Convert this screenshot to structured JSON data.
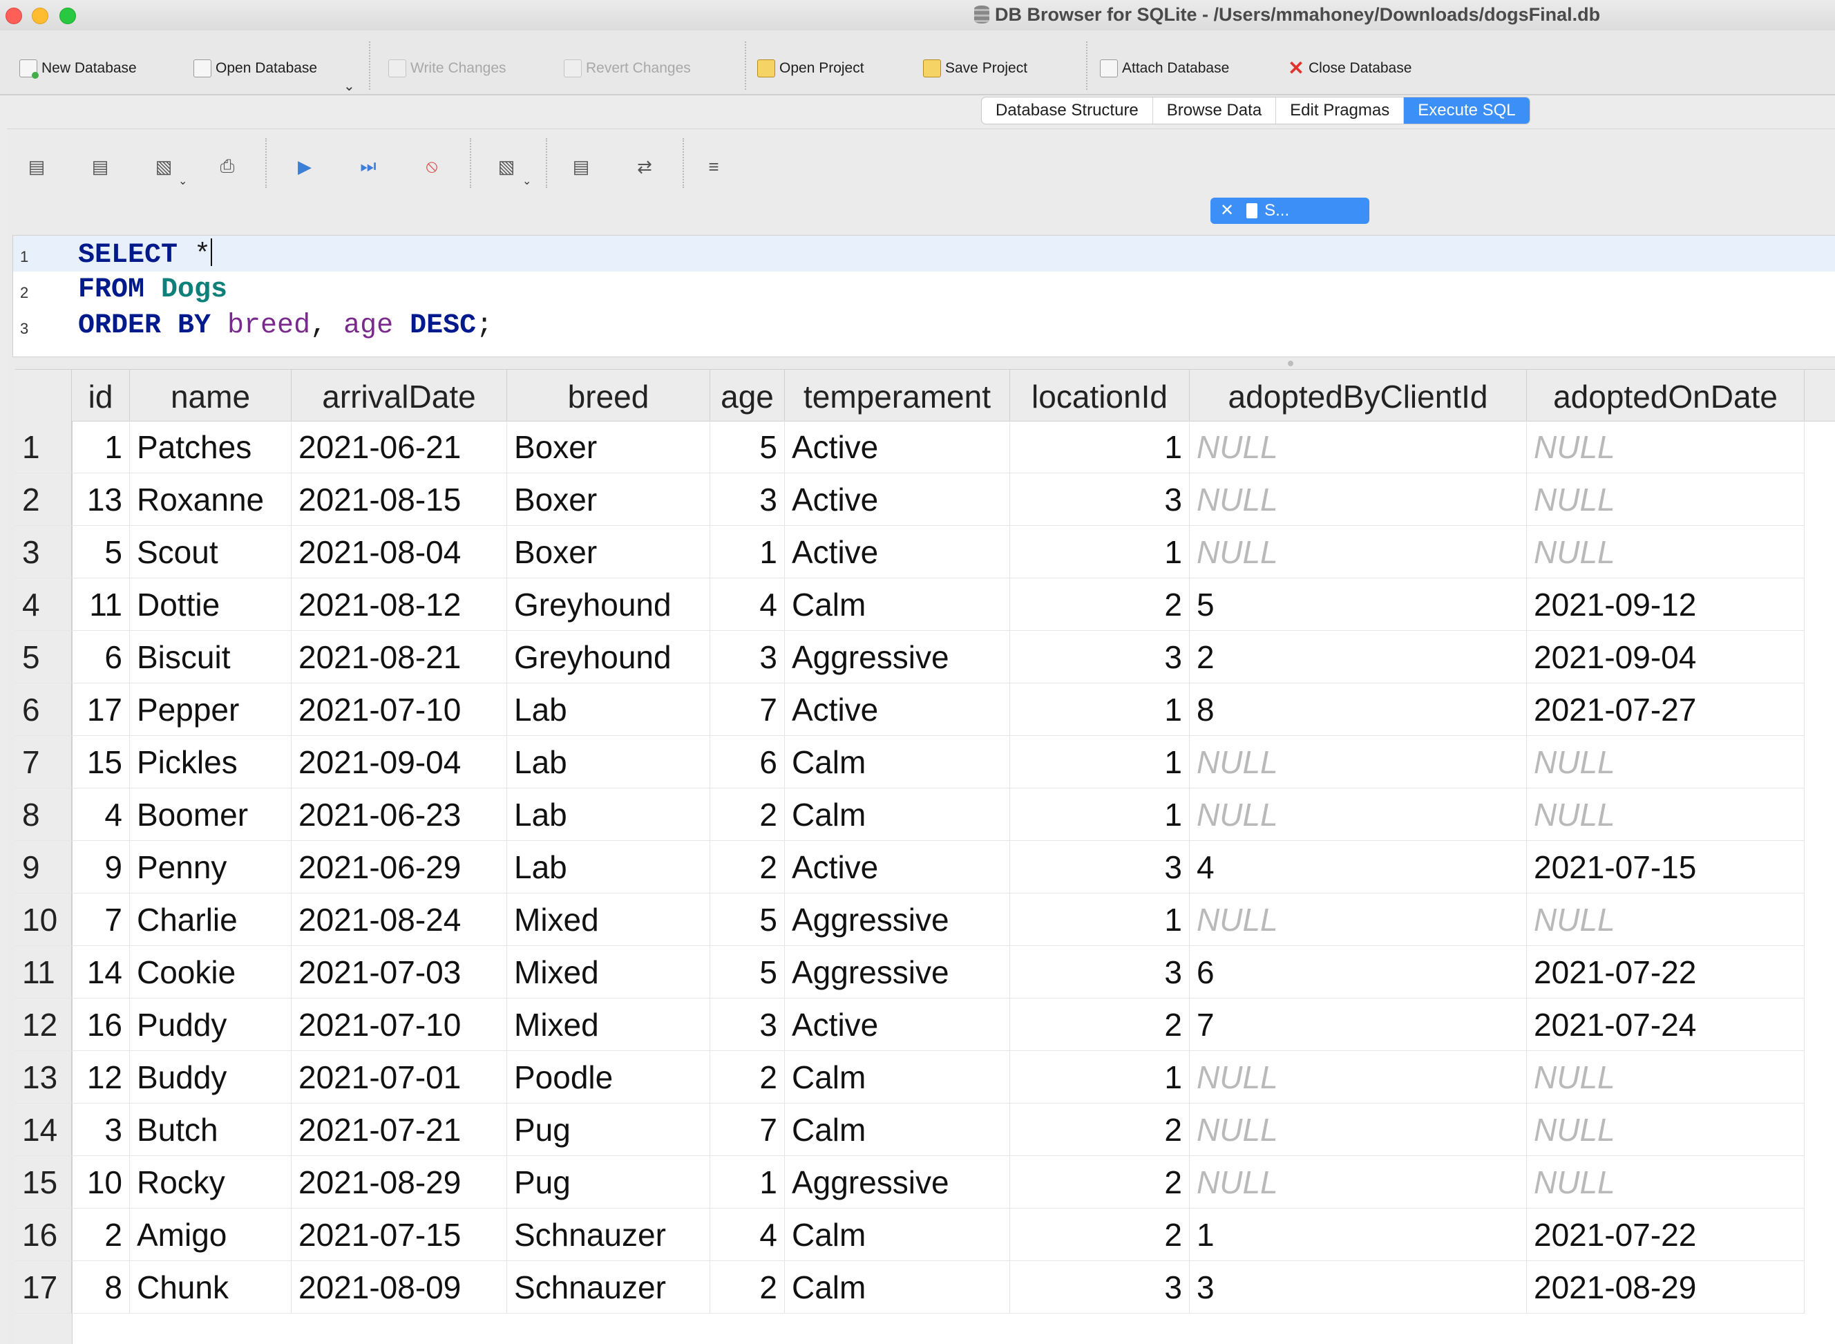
{
  "window": {
    "title": "DB Browser for SQLite - /Users/mmahoney/Downloads/dogsFinal.db"
  },
  "toolbar": {
    "new_database": "New Database",
    "open_database": "Open Database",
    "write_changes": "Write Changes",
    "revert_changes": "Revert Changes",
    "open_project": "Open Project",
    "save_project": "Save Project",
    "attach_database": "Attach Database",
    "close_database": "Close Database"
  },
  "tabs": [
    {
      "label": "Database Structure",
      "active": false
    },
    {
      "label": "Browse Data",
      "active": false
    },
    {
      "label": "Edit Pragmas",
      "active": false
    },
    {
      "label": "Execute SQL",
      "active": true
    }
  ],
  "editor_tab": {
    "label": "S..."
  },
  "sql": {
    "line_numbers": [
      "1",
      "2",
      "3"
    ],
    "line1": {
      "kw": "SELECT",
      "rest": " *"
    },
    "line2": {
      "kw": "FROM",
      "table": "Dogs"
    },
    "line3": {
      "kw1": "ORDER BY",
      "col1": "breed",
      "sep": ", ",
      "col2": "age",
      "kw2": "DESC",
      "end": ";"
    }
  },
  "results": {
    "columns": [
      "id",
      "name",
      "arrivalDate",
      "breed",
      "age",
      "temperament",
      "locationId",
      "adoptedByClientId",
      "adoptedOnDate"
    ],
    "rows": [
      [
        "1",
        "Patches",
        "2021-06-21",
        "Boxer",
        "5",
        "Active",
        "1",
        "NULL",
        "NULL"
      ],
      [
        "13",
        "Roxanne",
        "2021-08-15",
        "Boxer",
        "3",
        "Active",
        "3",
        "NULL",
        "NULL"
      ],
      [
        "5",
        "Scout",
        "2021-08-04",
        "Boxer",
        "1",
        "Active",
        "1",
        "NULL",
        "NULL"
      ],
      [
        "11",
        "Dottie",
        "2021-08-12",
        "Greyhound",
        "4",
        "Calm",
        "2",
        "5",
        "2021-09-12"
      ],
      [
        "6",
        "Biscuit",
        "2021-08-21",
        "Greyhound",
        "3",
        "Aggressive",
        "3",
        "2",
        "2021-09-04"
      ],
      [
        "17",
        "Pepper",
        "2021-07-10",
        "Lab",
        "7",
        "Active",
        "1",
        "8",
        "2021-07-27"
      ],
      [
        "15",
        "Pickles",
        "2021-09-04",
        "Lab",
        "6",
        "Calm",
        "1",
        "NULL",
        "NULL"
      ],
      [
        "4",
        "Boomer",
        "2021-06-23",
        "Lab",
        "2",
        "Calm",
        "1",
        "NULL",
        "NULL"
      ],
      [
        "9",
        "Penny",
        "2021-06-29",
        "Lab",
        "2",
        "Active",
        "3",
        "4",
        "2021-07-15"
      ],
      [
        "7",
        "Charlie",
        "2021-08-24",
        "Mixed",
        "5",
        "Aggressive",
        "1",
        "NULL",
        "NULL"
      ],
      [
        "14",
        "Cookie",
        "2021-07-03",
        "Mixed",
        "5",
        "Aggressive",
        "3",
        "6",
        "2021-07-22"
      ],
      [
        "16",
        "Puddy",
        "2021-07-10",
        "Mixed",
        "3",
        "Active",
        "2",
        "7",
        "2021-07-24"
      ],
      [
        "12",
        "Buddy",
        "2021-07-01",
        "Poodle",
        "2",
        "Calm",
        "1",
        "NULL",
        "NULL"
      ],
      [
        "3",
        "Butch",
        "2021-07-21",
        "Pug",
        "7",
        "Calm",
        "2",
        "NULL",
        "NULL"
      ],
      [
        "10",
        "Rocky",
        "2021-08-29",
        "Pug",
        "1",
        "Aggressive",
        "2",
        "NULL",
        "NULL"
      ],
      [
        "2",
        "Amigo",
        "2021-07-15",
        "Schnauzer",
        "4",
        "Calm",
        "2",
        "1",
        "2021-07-22"
      ],
      [
        "8",
        "Chunk",
        "2021-08-09",
        "Schnauzer",
        "2",
        "Calm",
        "3",
        "3",
        "2021-08-29"
      ]
    ]
  }
}
